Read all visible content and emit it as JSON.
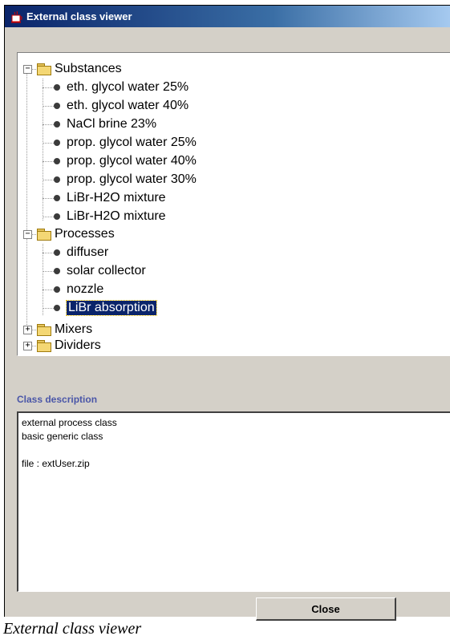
{
  "window": {
    "title": "External class viewer",
    "icon": "java-cup-icon"
  },
  "tree": {
    "groups": [
      {
        "label": "Substances",
        "expanded": true,
        "items": [
          "eth. glycol water 25%",
          "eth. glycol water 40%",
          "NaCl brine 23%",
          "prop. glycol water 25%",
          "prop. glycol water 40%",
          "prop. glycol water 30%",
          "LiBr-H2O mixture",
          "LiBr-H2O mixture"
        ]
      },
      {
        "label": "Processes",
        "expanded": true,
        "items": [
          "diffuser",
          "solar collector",
          "nozzle",
          "LiBr absorption"
        ]
      },
      {
        "label": "Mixers",
        "expanded": false,
        "items": []
      },
      {
        "label": "Dividers",
        "expanded": false,
        "items": []
      }
    ],
    "selected": "LiBr absorption"
  },
  "description": {
    "heading": "Class description",
    "text": "external process class\nbasic generic class\n\nfile : extUser.zip"
  },
  "buttons": {
    "close": "Close"
  },
  "caption": "External class viewer",
  "colors": {
    "selection": "#0a246a",
    "heading": "#4a56a8",
    "folder": "#f4d774"
  }
}
